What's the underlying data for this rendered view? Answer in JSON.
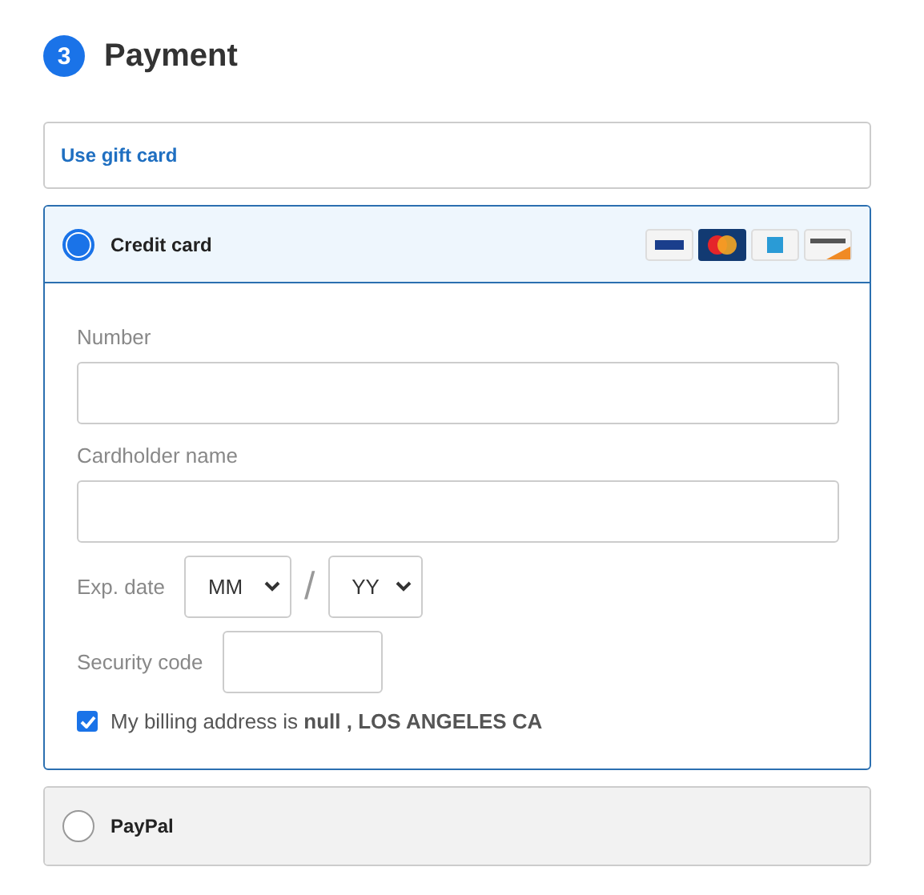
{
  "step": {
    "number": "3",
    "title": "Payment"
  },
  "gift_card": {
    "label": "Use gift card"
  },
  "methods": [
    {
      "label": "Credit card",
      "selected": true,
      "card_logos": true
    },
    {
      "label": "PayPal",
      "selected": false,
      "card_logos": false
    }
  ],
  "credit_form": {
    "number_label": "Number",
    "cardholder_label": "Cardholder name",
    "exp_label": "Exp. date",
    "month": "MM",
    "separator": "/",
    "year": "YY",
    "security_label": "Security code",
    "billing": {
      "text": "My billing address is **null , LOS ANGELES CA**",
      "checked": true
    }
  }
}
